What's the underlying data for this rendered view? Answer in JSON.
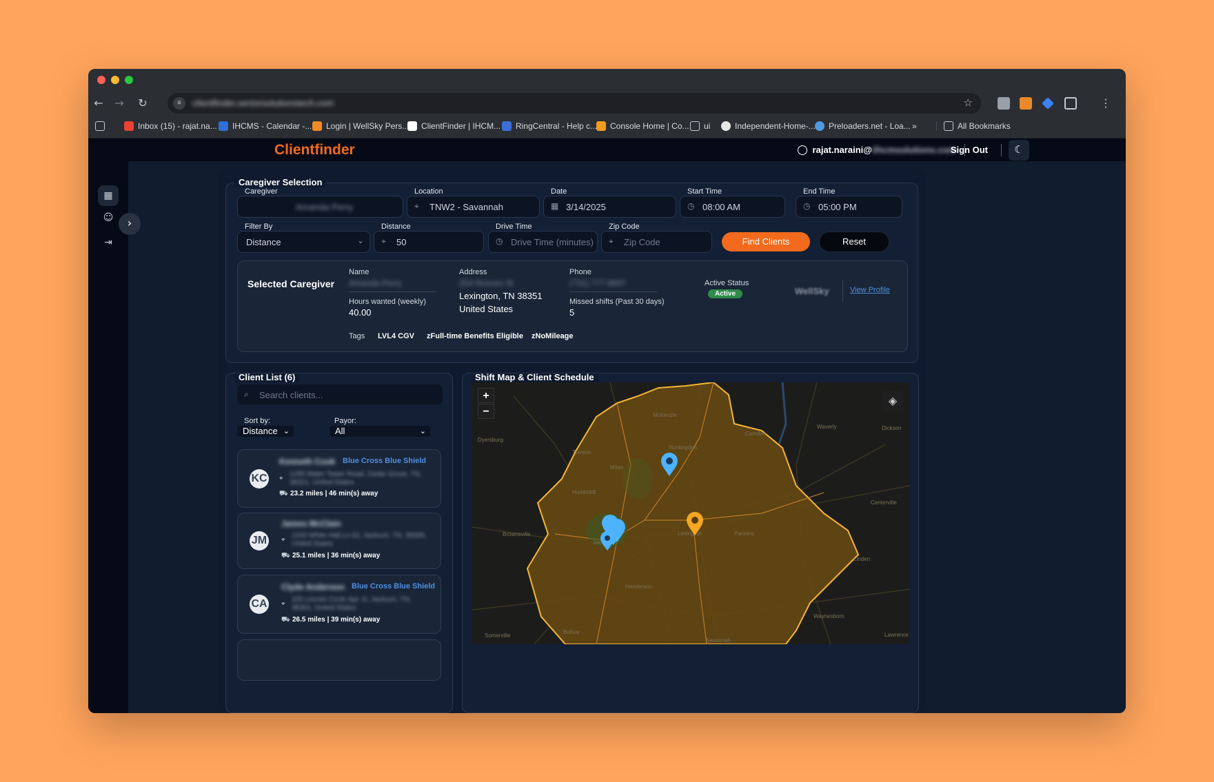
{
  "browser": {
    "url": "clientfinder.seniorsolutionstech.com",
    "bookmarks": [
      "Inbox (15) - rajat.na...",
      "IHCMS - Calendar -...",
      "Login | WellSky Pers...",
      "ClientFinder | IHCM...",
      "RingCentral - Help c...",
      "Console Home | Co...",
      "ui",
      "Independent-Home-...",
      "Preloaders.net - Loa...",
      "»",
      "All Bookmarks"
    ]
  },
  "header": {
    "brand": "Clientfinder",
    "user_email": "rajat.naraini@",
    "user_email_blurred": "iihcmsolutions.com",
    "sign_out": "Sign Out"
  },
  "caregiver_selection": {
    "title": "Caregiver Selection",
    "caregiver_label": "Caregiver",
    "caregiver_value": "Amanda Perry",
    "location_label": "Location",
    "location_value": "TNW2 - Savannah",
    "date_label": "Date",
    "date_value": "3/14/2025",
    "start_label": "Start Time",
    "start_value": "08:00 AM",
    "end_label": "End Time",
    "end_value": "05:00 PM",
    "filter_label": "Filter By",
    "filter_value": "Distance",
    "distance_label": "Distance",
    "distance_value": "50",
    "drive_label": "Drive Time",
    "drive_placeholder": "Drive Time (minutes)",
    "zip_label": "Zip Code",
    "zip_placeholder": "Zip Code",
    "find_button": "Find Clients",
    "reset_button": "Reset"
  },
  "selected_caregiver": {
    "title": "Selected Caregiver",
    "name_label": "Name",
    "name_value": "Amanda Perry",
    "hours_label": "Hours wanted (weekly)",
    "hours_value": "40.00",
    "address_label": "Address",
    "address_street": "254 Reeves St",
    "address_city": "Lexington, TN 38351",
    "address_country": "United States",
    "phone_label": "Phone",
    "phone_value": "(731) 777-8697",
    "missed_label": "Missed shifts (Past 30 days)",
    "missed_value": "5",
    "status_label": "Active Status",
    "status_value": "Active",
    "wellsky": "WellSky",
    "view_profile": "View Profile",
    "tags_label": "Tags",
    "tags": [
      "LVL4 CGV",
      "zFull-time Benefits Eligible",
      "zNoMileage"
    ]
  },
  "client_list": {
    "title": "Client List (6)",
    "search_placeholder": "Search clients...",
    "sort_label": "Sort by:",
    "sort_value": "Distance",
    "payor_label": "Payor:",
    "payor_value": "All",
    "clients": [
      {
        "initials": "KC",
        "name": "Kenneth Cook",
        "payor": "Blue Cross Blue Shield",
        "address": "1295 Water Tower Road, Cedar Grove, TN, 38321, United States",
        "distance": "23.2 miles | 46 min(s) away"
      },
      {
        "initials": "JM",
        "name": "James McClain",
        "payor": "",
        "address": "1243 White Hall Ln 62, Jackson, TN, 38305, United States",
        "distance": "25.1 miles | 36 min(s) away"
      },
      {
        "initials": "CA",
        "name": "Clyde Anderson",
        "payor": "Blue Cross Blue Shield",
        "address": "225 Lincoln Circle Apt. D, Jackson, TN, 38301, United States",
        "distance": "26.5 miles | 39 min(s) away"
      }
    ]
  },
  "map_section": {
    "title": "Shift Map & Client Schedule",
    "zoom_in": "+",
    "zoom_out": "−",
    "towns": [
      "McKenzie",
      "Waverly",
      "Dickson",
      "Camden",
      "Huntingdon",
      "Dyersburg",
      "Trenton",
      "Milan",
      "Humboldt",
      "Centerville",
      "Brownsville",
      "Jackson",
      "Lexington",
      "Parsons",
      "Henderson",
      "Linden",
      "Somerville",
      "Bolivar",
      "Savannah",
      "Waynesboro",
      "Lawrence"
    ]
  },
  "colors": {
    "accent": "#f26b1d",
    "client_pin": "#4db3ff",
    "caregiver_pin": "#f5a623",
    "active": "#2e8b4a"
  }
}
